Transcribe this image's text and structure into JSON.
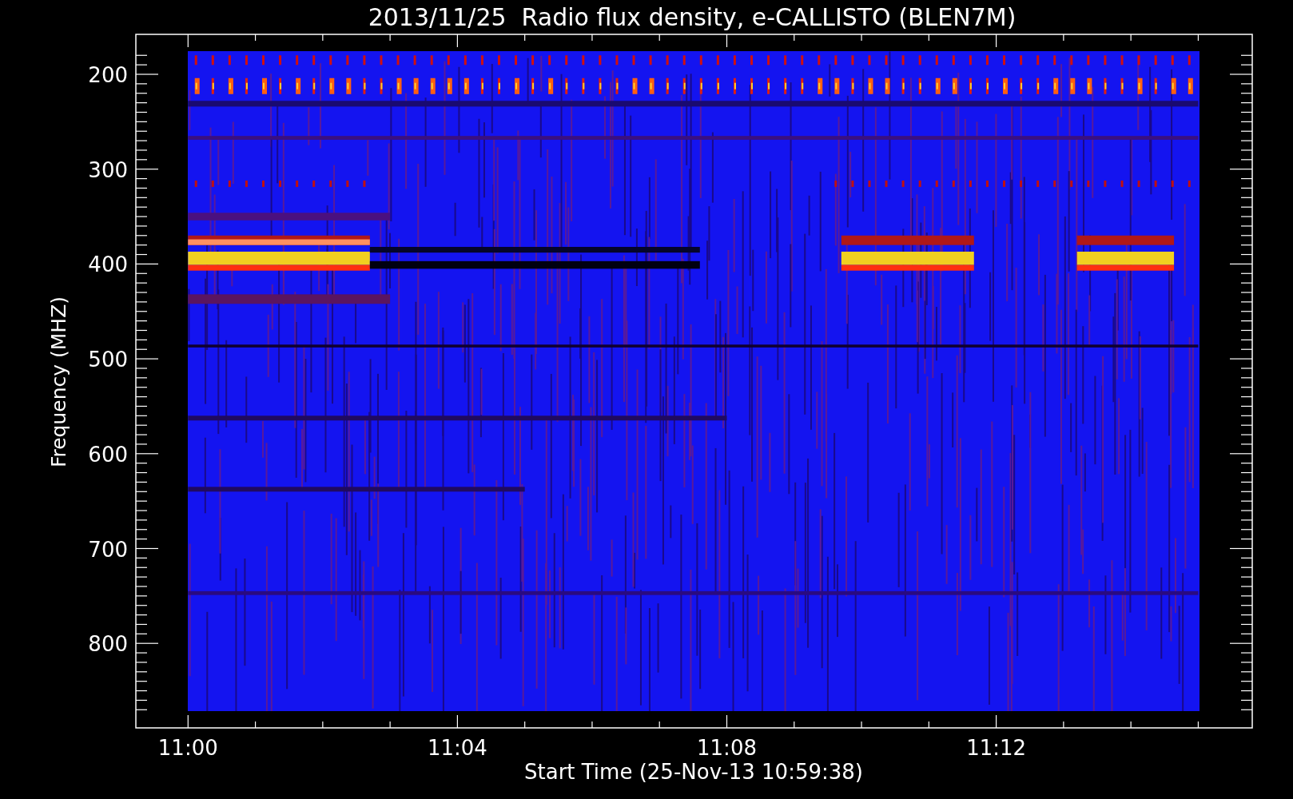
{
  "title": "2013/11/25  Radio flux density, e-CALLISTO (BLEN7M)",
  "y_axis": {
    "label": "Frequency (MHZ)",
    "ticks": [
      "200",
      "300",
      "400",
      "500",
      "600",
      "700",
      "800"
    ]
  },
  "x_axis": {
    "label": "Start Time (25-Nov-13 10:59:38)",
    "ticks": [
      "11:00",
      "11:04",
      "11:08",
      "11:12"
    ]
  }
}
